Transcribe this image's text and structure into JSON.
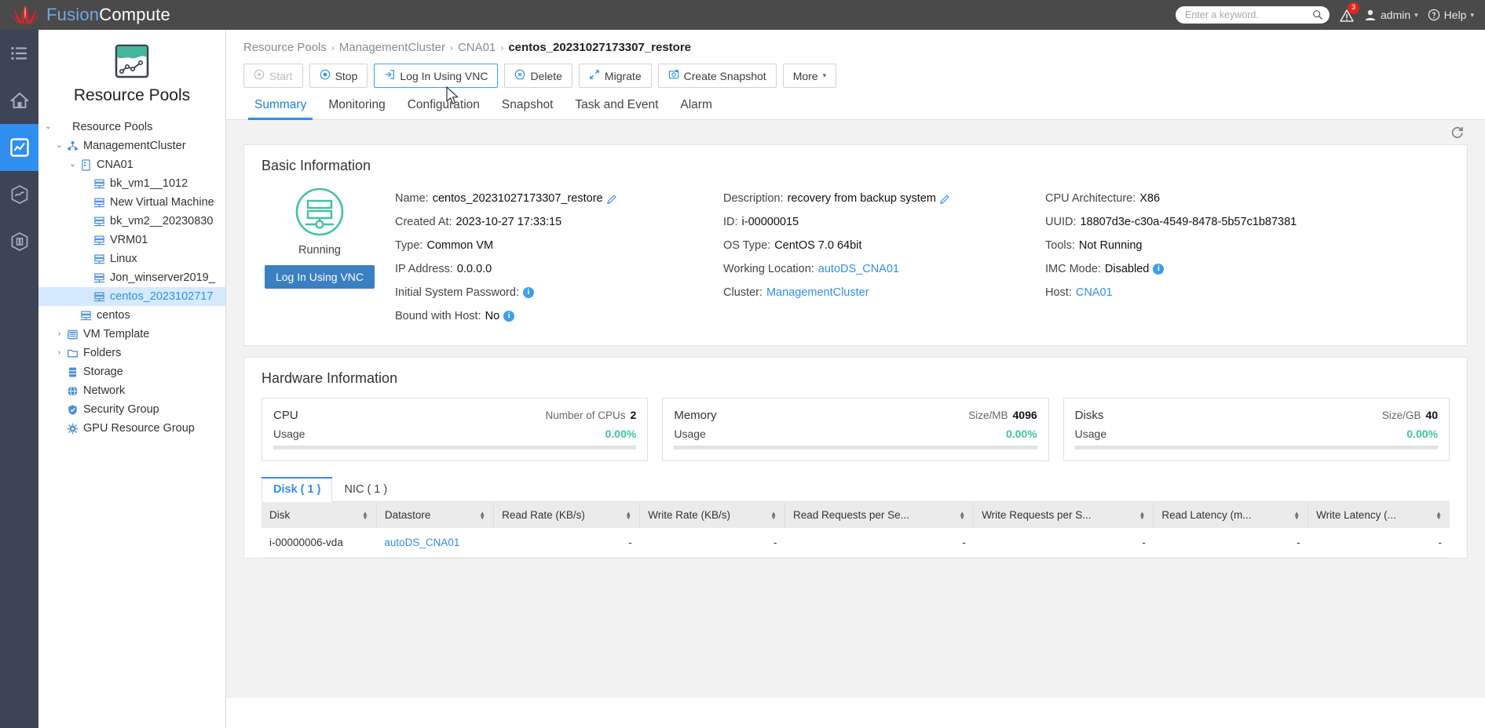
{
  "app": {
    "brand_primary": "Fusion",
    "brand_secondary": "Compute",
    "brand_color": "#72a8e0"
  },
  "topbar": {
    "search_placeholder": "Enter a keyword.",
    "search_value": "",
    "alert_badge": "3",
    "user_label": "admin",
    "help_label": "Help",
    "caret": "▾"
  },
  "rail": {
    "items": [
      {
        "name": "menu-icon"
      },
      {
        "name": "home-icon"
      },
      {
        "name": "monitor-icon"
      },
      {
        "name": "resource-icon"
      },
      {
        "name": "service-icon"
      }
    ]
  },
  "sidebar": {
    "title": "Resource Pools",
    "tree": [
      {
        "label": "Resource Pools",
        "level": 1,
        "twist": "⌄",
        "icon": "",
        "selected": false
      },
      {
        "label": "ManagementCluster",
        "level": 2,
        "twist": "⌄",
        "icon": "cluster-icon",
        "selected": false
      },
      {
        "label": "CNA01",
        "level": 3,
        "twist": "⌄",
        "icon": "host-icon",
        "selected": false
      },
      {
        "label": "bk_vm1__1012",
        "level": 4,
        "twist": "",
        "icon": "vm-icon",
        "selected": false
      },
      {
        "label": "New Virtual Machine",
        "level": 4,
        "twist": "",
        "icon": "vm-icon",
        "selected": false
      },
      {
        "label": "bk_vm2__20230830",
        "level": 4,
        "twist": "",
        "icon": "vm-icon",
        "selected": false
      },
      {
        "label": "VRM01",
        "level": 4,
        "twist": "",
        "icon": "vm-icon",
        "selected": false
      },
      {
        "label": "Linux",
        "level": 4,
        "twist": "",
        "icon": "vm-icon",
        "selected": false
      },
      {
        "label": "Jon_winserver2019_",
        "level": 4,
        "twist": "",
        "icon": "vm-icon",
        "selected": false
      },
      {
        "label": "centos_2023102717",
        "level": 4,
        "twist": "",
        "icon": "vm-icon",
        "selected": true
      },
      {
        "label": "centos",
        "level": 3,
        "twist": "",
        "icon": "vm-icon",
        "selected": false
      },
      {
        "label": "VM Template",
        "level": 2,
        "twist": "›",
        "icon": "template-icon",
        "selected": false
      },
      {
        "label": "Folders",
        "level": 2,
        "twist": "›",
        "icon": "folder-icon",
        "selected": false
      },
      {
        "label": "Storage",
        "level": 2,
        "twist": "",
        "icon": "storage-icon",
        "selected": false
      },
      {
        "label": "Network",
        "level": 2,
        "twist": "",
        "icon": "network-icon",
        "selected": false
      },
      {
        "label": "Security Group",
        "level": 2,
        "twist": "",
        "icon": "shield-icon",
        "selected": false
      },
      {
        "label": "GPU Resource Group",
        "level": 2,
        "twist": "",
        "icon": "gpu-icon",
        "selected": false
      }
    ]
  },
  "breadcrumb": {
    "items": [
      "Resource Pools",
      "ManagementCluster",
      "CNA01"
    ],
    "current": "centos_20231027173307_restore",
    "separator": "›"
  },
  "toolbar": {
    "buttons": [
      {
        "label": "Start",
        "icon": "play-circle-icon",
        "disabled": true,
        "focused": false,
        "caret": false
      },
      {
        "label": "Stop",
        "icon": "stop-circle-icon",
        "disabled": false,
        "focused": false,
        "caret": false
      },
      {
        "label": "Log In Using VNC",
        "icon": "login-icon",
        "disabled": false,
        "focused": true,
        "caret": false
      },
      {
        "label": "Delete",
        "icon": "delete-circle-icon",
        "disabled": false,
        "focused": false,
        "caret": false
      },
      {
        "label": "Migrate",
        "icon": "migrate-icon",
        "disabled": false,
        "focused": false,
        "caret": false
      },
      {
        "label": "Create Snapshot",
        "icon": "snapshot-icon",
        "disabled": false,
        "focused": false,
        "caret": false
      },
      {
        "label": "More",
        "icon": "",
        "disabled": false,
        "focused": false,
        "caret": true
      }
    ]
  },
  "tabs": {
    "items": [
      "Summary",
      "Monitoring",
      "Configuration",
      "Snapshot",
      "Task and Event",
      "Alarm"
    ],
    "active": "Summary"
  },
  "basic_information": {
    "heading": "Basic Information",
    "status_text": "Running",
    "status_color": "#3fc3a0",
    "vnc_button": "Log In Using VNC",
    "col1": [
      {
        "key": "Name:",
        "value": "centos_20231027173307_restore",
        "edit": true,
        "info": false,
        "link": false
      },
      {
        "key": "Created At:",
        "value": "2023-10-27 17:33:15",
        "edit": false,
        "info": false,
        "link": false
      },
      {
        "key": "Type:",
        "value": "Common VM",
        "edit": false,
        "info": false,
        "link": false
      },
      {
        "key": "IP Address:",
        "value": "0.0.0.0",
        "edit": false,
        "info": false,
        "link": false
      },
      {
        "key": "Initial System Password:",
        "value": "",
        "edit": false,
        "info": true,
        "link": false
      },
      {
        "key": "Bound with Host:",
        "value": "No",
        "edit": false,
        "info": true,
        "link": false
      }
    ],
    "col2": [
      {
        "key": "Description:",
        "value": "recovery from backup system",
        "edit": true,
        "info": false,
        "link": false
      },
      {
        "key": "ID:",
        "value": "i-00000015",
        "edit": false,
        "info": false,
        "link": false
      },
      {
        "key": "OS Type:",
        "value": "CentOS 7.0 64bit",
        "edit": false,
        "info": false,
        "link": false
      },
      {
        "key": "Working Location:",
        "value": "autoDS_CNA01",
        "edit": false,
        "info": false,
        "link": true
      },
      {
        "key": "Cluster:",
        "value": "ManagementCluster",
        "edit": false,
        "info": false,
        "link": true
      }
    ],
    "col3": [
      {
        "key": "CPU Architecture:",
        "value": "X86",
        "edit": false,
        "info": false,
        "link": false
      },
      {
        "key": "UUID:",
        "value": "18807d3e-c30a-4549-8478-5b57c1b87381",
        "edit": false,
        "info": false,
        "link": false
      },
      {
        "key": "Tools:",
        "value": "Not Running",
        "edit": false,
        "info": false,
        "link": false
      },
      {
        "key": "IMC Mode:",
        "value": "Disabled",
        "edit": false,
        "info": true,
        "link": false
      },
      {
        "key": "Host:",
        "value": "CNA01",
        "edit": false,
        "info": false,
        "link": true
      }
    ]
  },
  "hardware_information": {
    "heading": "Hardware Information",
    "cards": [
      {
        "title": "CPU",
        "metric_label": "Number of CPUs",
        "metric_value": "2",
        "usage_label": "Usage",
        "usage_value": "0.00%",
        "usage_pct": 0
      },
      {
        "title": "Memory",
        "metric_label": "Size/MB",
        "metric_value": "4096",
        "usage_label": "Usage",
        "usage_value": "0.00%",
        "usage_pct": 0
      },
      {
        "title": "Disks",
        "metric_label": "Size/GB",
        "metric_value": "40",
        "usage_label": "Usage",
        "usage_value": "0.00%",
        "usage_pct": 0
      }
    ],
    "device_tabs": [
      {
        "label": "Disk ( 1 )",
        "active": true
      },
      {
        "label": "NIC ( 1 )",
        "active": false
      }
    ],
    "table": {
      "columns": [
        "Disk",
        "Datastore",
        "Read Rate (KB/s)",
        "Write Rate (KB/s)",
        "Read Requests per Se...",
        "Write Requests per S...",
        "Read Latency (m...",
        "Write Latency (..."
      ],
      "rows": [
        {
          "disk": "i-00000006-vda",
          "datastore": "autoDS_CNA01",
          "read_rate": "-",
          "write_rate": "-",
          "read_requests": "-",
          "write_requests": "-",
          "read_latency": "-",
          "write_latency": "-"
        }
      ]
    }
  },
  "refresh": {
    "name": "refresh-icon"
  }
}
